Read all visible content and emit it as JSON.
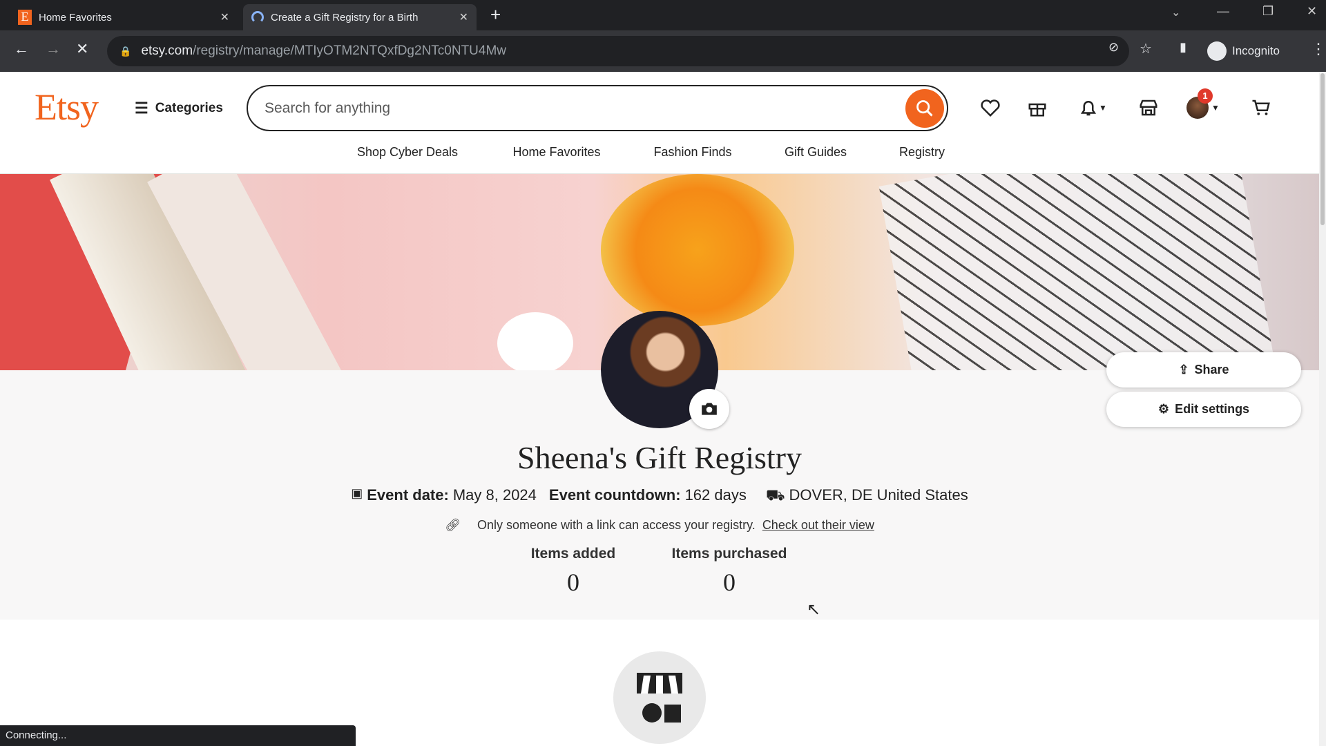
{
  "browser": {
    "tabs": [
      {
        "title": "Home Favorites",
        "active": false
      },
      {
        "title": "Create a Gift Registry for a Birth",
        "active": true
      }
    ],
    "url_domain": "etsy.com",
    "url_path": "/registry/manage/MTIyOTM2NTQxfDg2NTc0NTU4Mw",
    "profile": "Incognito",
    "status": "Connecting..."
  },
  "header": {
    "logo": "Etsy",
    "categories": "Categories",
    "search_placeholder": "Search for anything",
    "notification_count": "1",
    "accent": "#F1641E"
  },
  "nav": [
    "Shop Cyber Deals",
    "Home Favorites",
    "Fashion Finds",
    "Gift Guides",
    "Registry"
  ],
  "registry": {
    "title": "Sheena's Gift Registry",
    "event_date_label": "Event date:",
    "event_date": "May 8, 2024",
    "countdown_label": "Event countdown:",
    "countdown": "162 days",
    "location": "DOVER, DE United States",
    "privacy_text": "Only someone with a link can access your registry.",
    "privacy_link": "Check out their view",
    "items_added_label": "Items added",
    "items_added": "0",
    "items_purchased_label": "Items purchased",
    "items_purchased": "0",
    "share": "Share",
    "edit_settings": "Edit settings"
  }
}
